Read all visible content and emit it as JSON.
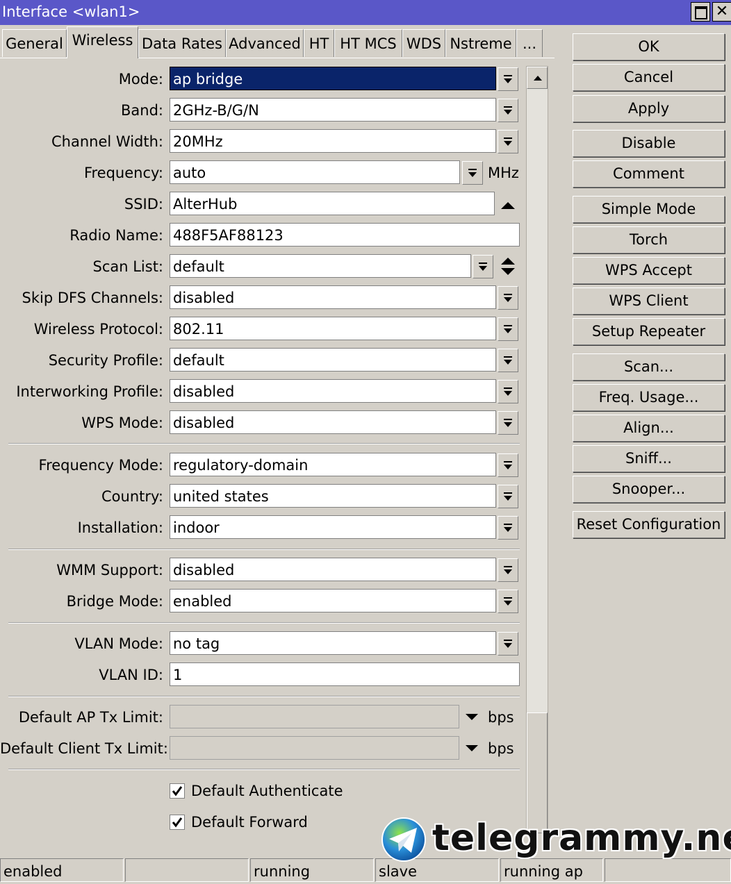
{
  "window": {
    "title": "Interface <wlan1>",
    "maximize_label": "",
    "close_label": "✕"
  },
  "tabs": [
    "General",
    "Wireless",
    "Data Rates",
    "Advanced",
    "HT",
    "HT MCS",
    "WDS",
    "Nstreme",
    "..."
  ],
  "active_tab": "Wireless",
  "fields": {
    "mode": {
      "label": "Mode:",
      "value": "ap bridge"
    },
    "band": {
      "label": "Band:",
      "value": "2GHz-B/G/N"
    },
    "channel_width": {
      "label": "Channel Width:",
      "value": "20MHz"
    },
    "frequency": {
      "label": "Frequency:",
      "value": "auto",
      "unit": "MHz"
    },
    "ssid": {
      "label": "SSID:",
      "value": "AlterHub"
    },
    "radio_name": {
      "label": "Radio Name:",
      "value": "488F5AF88123"
    },
    "scan_list": {
      "label": "Scan List:",
      "value": "default"
    },
    "skip_dfs": {
      "label": "Skip DFS Channels:",
      "value": "disabled"
    },
    "wireless_protocol": {
      "label": "Wireless Protocol:",
      "value": "802.11"
    },
    "security_profile": {
      "label": "Security Profile:",
      "value": "default"
    },
    "interworking_profile": {
      "label": "Interworking Profile:",
      "value": "disabled"
    },
    "wps_mode": {
      "label": "WPS Mode:",
      "value": "disabled"
    },
    "frequency_mode": {
      "label": "Frequency Mode:",
      "value": "regulatory-domain"
    },
    "country": {
      "label": "Country:",
      "value": "united states"
    },
    "installation": {
      "label": "Installation:",
      "value": "indoor"
    },
    "wmm_support": {
      "label": "WMM Support:",
      "value": "disabled"
    },
    "bridge_mode": {
      "label": "Bridge Mode:",
      "value": "enabled"
    },
    "vlan_mode": {
      "label": "VLAN Mode:",
      "value": "no tag"
    },
    "vlan_id": {
      "label": "VLAN ID:",
      "value": "1"
    },
    "default_ap_tx_limit": {
      "label": "Default AP Tx Limit:",
      "value": "",
      "unit": "bps"
    },
    "default_client_tx_limit": {
      "label": "Default Client Tx Limit:",
      "value": "",
      "unit": "bps"
    }
  },
  "checkboxes": {
    "default_authenticate": {
      "label": "Default Authenticate",
      "checked": true
    },
    "default_forward": {
      "label": "Default Forward",
      "checked": true
    }
  },
  "buttons": {
    "ok": "OK",
    "cancel": "Cancel",
    "apply": "Apply",
    "disable": "Disable",
    "comment": "Comment",
    "simple_mode": "Simple Mode",
    "torch": "Torch",
    "wps_accept": "WPS Accept",
    "wps_client": "WPS Client",
    "setup_repeater": "Setup Repeater",
    "scan": "Scan...",
    "freq_usage": "Freq. Usage...",
    "align": "Align...",
    "sniff": "Sniff...",
    "snooper": "Snooper...",
    "reset_configuration": "Reset Configuration"
  },
  "status": [
    "enabled",
    "",
    "running",
    "slave",
    "running ap",
    ""
  ],
  "watermark": {
    "text": "telegrammy.net"
  },
  "colors": {
    "titlebar": "#5a57c8",
    "window_bg": "#d4d0c8",
    "selection": "#0a246a"
  }
}
